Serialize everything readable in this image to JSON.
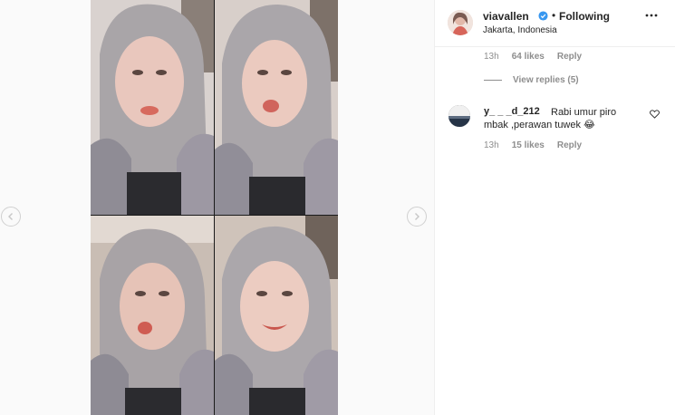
{
  "post": {
    "username": "viavallen",
    "follow_status": "Following",
    "location": "Jakarta, Indonesia",
    "separator": "•"
  },
  "comments": {
    "first_meta": {
      "time": "13h",
      "likes": "64 likes",
      "reply": "Reply"
    },
    "view_replies": "View replies (5)",
    "second": {
      "username": "y_ _ _d_212",
      "text_line1": "Rabi umur piro",
      "text_line2": "mbak ,perawan tuwek 😂",
      "time": "13h",
      "likes": "15 likes",
      "reply": "Reply"
    }
  },
  "icons": {
    "verified": "verified-badge-icon",
    "more": "more-options-icon",
    "heart": "heart-icon",
    "prev": "chevron-left-icon",
    "next": "chevron-right-icon"
  },
  "colors": {
    "verified_blue": "#3897f0",
    "text_primary": "#262626",
    "text_secondary": "#8e8e8e",
    "border": "#efefef"
  }
}
